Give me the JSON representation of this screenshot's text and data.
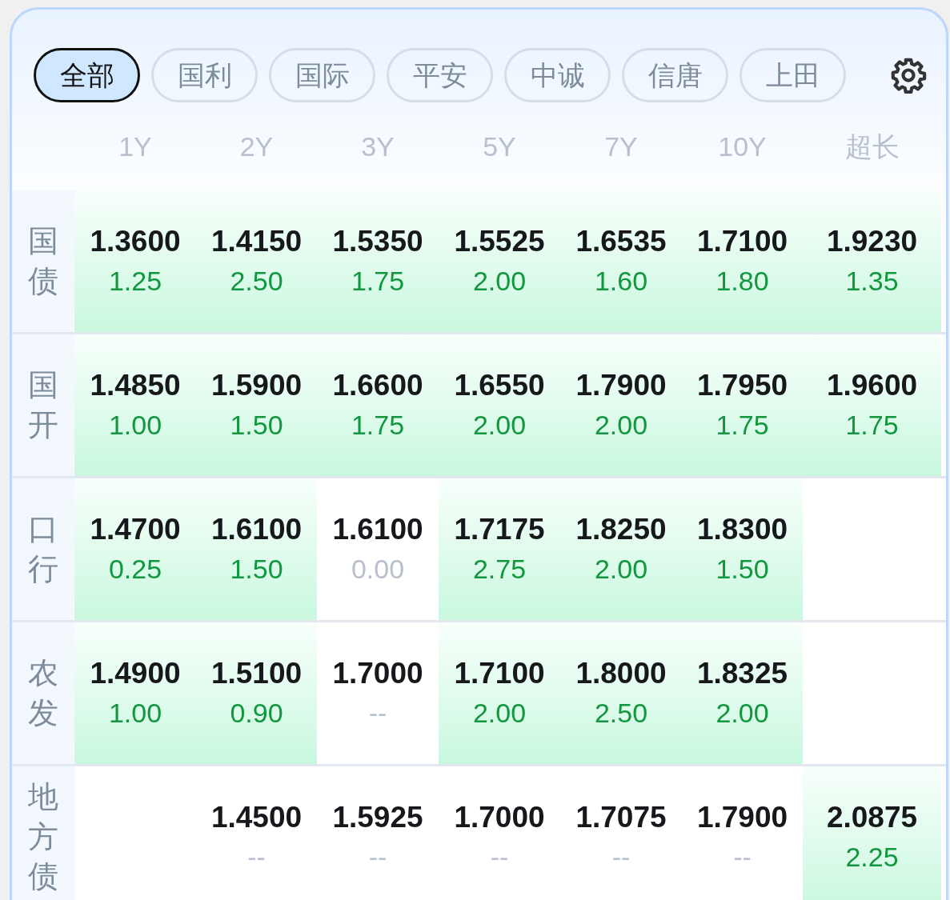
{
  "filters": [
    {
      "label": "全部",
      "selected": true
    },
    {
      "label": "国利",
      "selected": false
    },
    {
      "label": "国际",
      "selected": false
    },
    {
      "label": "平安",
      "selected": false
    },
    {
      "label": "中诚",
      "selected": false
    },
    {
      "label": "信唐",
      "selected": false
    },
    {
      "label": "上田",
      "selected": false
    }
  ],
  "columns": [
    "1Y",
    "2Y",
    "3Y",
    "5Y",
    "7Y",
    "10Y",
    "超长"
  ],
  "rows": [
    {
      "label": "国债",
      "cells": [
        {
          "kind": "quote",
          "price": "1.3600",
          "change": "1.25",
          "highlighted": true
        },
        {
          "kind": "quote",
          "price": "1.4150",
          "change": "2.50",
          "highlighted": true
        },
        {
          "kind": "quote",
          "price": "1.5350",
          "change": "1.75",
          "highlighted": true
        },
        {
          "kind": "quote",
          "price": "1.5525",
          "change": "2.00",
          "highlighted": true
        },
        {
          "kind": "quote",
          "price": "1.6535",
          "change": "1.60",
          "highlighted": true
        },
        {
          "kind": "quote",
          "price": "1.7100",
          "change": "1.80",
          "highlighted": true
        },
        {
          "kind": "quote",
          "price": "1.9230",
          "change": "1.35",
          "highlighted": true
        }
      ]
    },
    {
      "label": "国开",
      "cells": [
        {
          "kind": "quote",
          "price": "1.4850",
          "change": "1.00",
          "highlighted": true
        },
        {
          "kind": "quote",
          "price": "1.5900",
          "change": "1.50",
          "highlighted": true
        },
        {
          "kind": "quote",
          "price": "1.6600",
          "change": "1.75",
          "highlighted": true
        },
        {
          "kind": "quote",
          "price": "1.6550",
          "change": "2.00",
          "highlighted": true
        },
        {
          "kind": "quote",
          "price": "1.7900",
          "change": "2.00",
          "highlighted": true
        },
        {
          "kind": "quote",
          "price": "1.7950",
          "change": "1.75",
          "highlighted": true
        },
        {
          "kind": "quote",
          "price": "1.9600",
          "change": "1.75",
          "highlighted": true
        }
      ]
    },
    {
      "label": "口行",
      "cells": [
        {
          "kind": "quote",
          "price": "1.4700",
          "change": "0.25",
          "highlighted": true
        },
        {
          "kind": "quote",
          "price": "1.6100",
          "change": "1.50",
          "highlighted": true
        },
        {
          "kind": "quote",
          "price": "1.6100",
          "change": "0.00",
          "highlighted": false
        },
        {
          "kind": "quote",
          "price": "1.7175",
          "change": "2.75",
          "highlighted": true
        },
        {
          "kind": "quote",
          "price": "1.8250",
          "change": "2.00",
          "highlighted": true
        },
        {
          "kind": "quote",
          "price": "1.8300",
          "change": "1.50",
          "highlighted": true
        },
        {
          "kind": "empty"
        }
      ]
    },
    {
      "label": "农发",
      "cells": [
        {
          "kind": "quote",
          "price": "1.4900",
          "change": "1.00",
          "highlighted": true
        },
        {
          "kind": "quote",
          "price": "1.5100",
          "change": "0.90",
          "highlighted": true
        },
        {
          "kind": "quote",
          "price": "1.7000",
          "change": "--",
          "highlighted": false
        },
        {
          "kind": "quote",
          "price": "1.7100",
          "change": "2.00",
          "highlighted": true
        },
        {
          "kind": "quote",
          "price": "1.8000",
          "change": "2.50",
          "highlighted": true
        },
        {
          "kind": "quote",
          "price": "1.8325",
          "change": "2.00",
          "highlighted": true
        },
        {
          "kind": "empty"
        }
      ]
    },
    {
      "label": "地方债",
      "cells": [
        {
          "kind": "empty"
        },
        {
          "kind": "quote",
          "price": "1.4500",
          "change": "--",
          "highlighted": false
        },
        {
          "kind": "quote",
          "price": "1.5925",
          "change": "--",
          "highlighted": false
        },
        {
          "kind": "quote",
          "price": "1.7000",
          "change": "--",
          "highlighted": false
        },
        {
          "kind": "quote",
          "price": "1.7075",
          "change": "--",
          "highlighted": false
        },
        {
          "kind": "quote",
          "price": "1.7900",
          "change": "--",
          "highlighted": false
        },
        {
          "kind": "quote",
          "price": "2.0875",
          "change": "2.25",
          "highlighted": true
        }
      ]
    }
  ]
}
